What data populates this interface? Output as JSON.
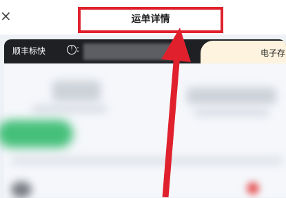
{
  "topbar": {
    "back_icon": "close-icon",
    "title": "运单详情"
  },
  "card": {
    "service_label": "顺丰标快",
    "info_icon_glyph": "!",
    "colon": ":",
    "tag_text": "电子存"
  },
  "annotation": {
    "color": "#e0212d"
  }
}
